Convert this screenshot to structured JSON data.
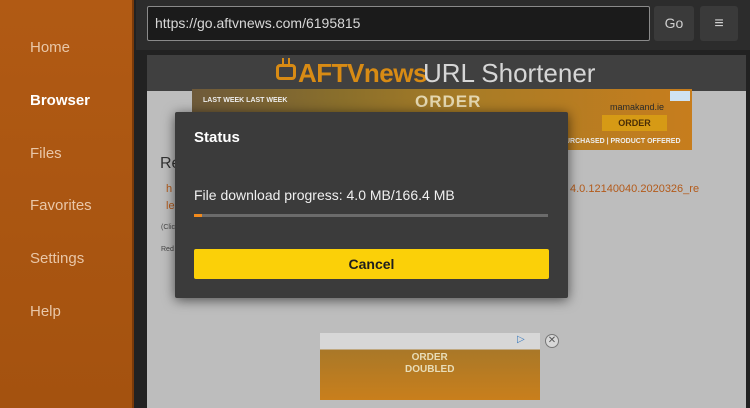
{
  "sidebar": {
    "items": [
      {
        "label": "Home",
        "active": false
      },
      {
        "label": "Browser",
        "active": true
      },
      {
        "label": "Files",
        "active": false
      },
      {
        "label": "Favorites",
        "active": false
      },
      {
        "label": "Settings",
        "active": false
      },
      {
        "label": "Help",
        "active": false
      }
    ]
  },
  "toolbar": {
    "url": "https://go.aftvnews.com/6195815",
    "go_label": "Go",
    "menu_icon": "hamburger-menu-icon"
  },
  "webpage": {
    "logo_text": "AFTVnews",
    "title": "URL Shortener",
    "heading_fragment": "Re",
    "link_fragment_1": "h",
    "link_fragment_2": "le",
    "link_right": "4.0.12140040.2020326_re",
    "tiny_text_1": "(Clic",
    "tiny_text_2": "Red",
    "ad_top": {
      "headline": "ORDER",
      "strip_left": "LAST WEEK   LAST WEEK",
      "brand": "mamakand.ie",
      "button": "ORDER",
      "strip_right": "URCHASED | PRODUCT OFFERED"
    },
    "ad_bottom": {
      "headline_1": "ORDER",
      "headline_2": "DOUBLED",
      "adchoices": "▷",
      "close": "✕"
    }
  },
  "dialog": {
    "title": "Status",
    "progress_text": "File download progress: 4.0 MB/166.4 MB",
    "progress_fraction": 0.024,
    "cancel_label": "Cancel",
    "accent_color": "#fbd008",
    "progress_color": "#f28a1c"
  }
}
